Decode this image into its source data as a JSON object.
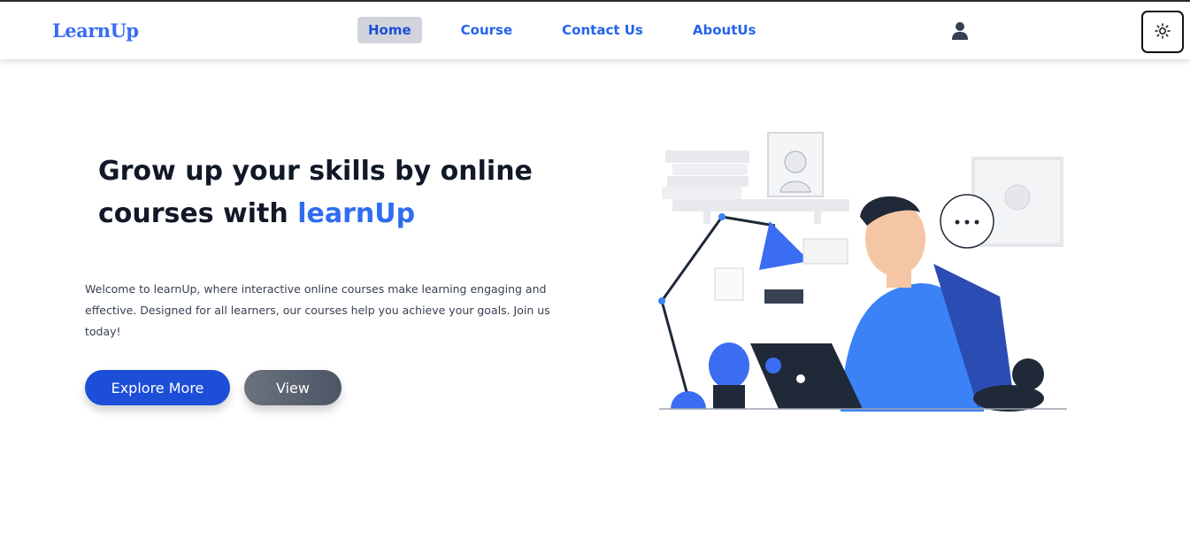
{
  "brand": {
    "logo_text": "LearnUp"
  },
  "nav": {
    "links": [
      {
        "label": "Home",
        "active": true
      },
      {
        "label": "Course",
        "active": false
      },
      {
        "label": "Contact Us",
        "active": false
      },
      {
        "label": "AboutUs",
        "active": false
      }
    ],
    "user_icon": "user-icon",
    "theme_icon": "sun-icon"
  },
  "hero": {
    "title_line1": "Grow up your skills by online",
    "title_line2_prefix": "courses with ",
    "title_accent": "learnUp",
    "description": "Welcome to learnUp, where interactive online courses make learning engaging and effective. Designed for all learners, our courses help you achieve your goals. Join us today!",
    "primary_button": "Explore More",
    "secondary_button": "View"
  },
  "colors": {
    "accent": "#2f6df0",
    "primary_button": "#1d4ed8",
    "secondary_button": "#5b6270"
  }
}
